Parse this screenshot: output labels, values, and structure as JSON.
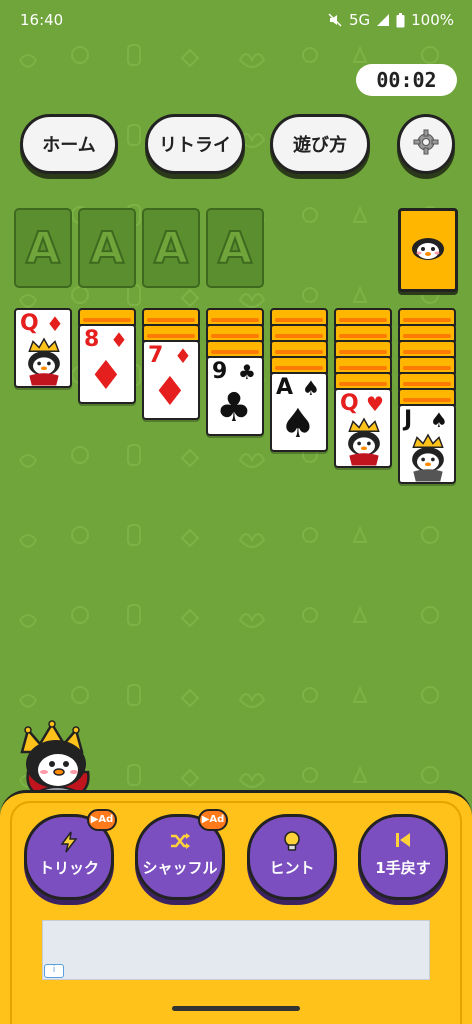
{
  "status_bar": {
    "time": "16:40",
    "network": "5G",
    "battery": "100%"
  },
  "timer": "00:02",
  "top_buttons": {
    "home": "ホーム",
    "retry": "リトライ",
    "how_to_play": "遊び方"
  },
  "foundations": [
    "A",
    "A",
    "A",
    "A"
  ],
  "tableau": [
    {
      "hidden": 0,
      "cards": [
        {
          "rank": "Q",
          "suit": "♦",
          "color": "red"
        }
      ]
    },
    {
      "hidden": 1,
      "cards": [
        {
          "rank": "8",
          "suit": "♦",
          "color": "red"
        }
      ]
    },
    {
      "hidden": 2,
      "cards": [
        {
          "rank": "7",
          "suit": "♦",
          "color": "red"
        }
      ]
    },
    {
      "hidden": 3,
      "cards": [
        {
          "rank": "9",
          "suit": "♣",
          "color": "black"
        }
      ]
    },
    {
      "hidden": 4,
      "cards": [
        {
          "rank": "A",
          "suit": "♠",
          "color": "black"
        }
      ]
    },
    {
      "hidden": 5,
      "cards": [
        {
          "rank": "Q",
          "suit": "♥",
          "color": "red"
        }
      ]
    },
    {
      "hidden": 6,
      "cards": [
        {
          "rank": "J",
          "suit": "♠",
          "color": "black"
        }
      ]
    }
  ],
  "actions": [
    {
      "label": "トリック",
      "badge": "▶Ad",
      "icon": "lightning-icon"
    },
    {
      "label": "シャッフル",
      "badge": "▶Ad",
      "icon": "shuffle-icon"
    },
    {
      "label": "ヒント",
      "badge": "",
      "icon": "lightbulb-icon"
    },
    {
      "label": "1手戻す",
      "badge": "",
      "icon": "undo-icon"
    }
  ],
  "colors": {
    "background": "#6fa53a",
    "panel": "#ffc21a",
    "action_button": "#7b4fc0",
    "card_back": "#ffb600",
    "red_suit": "#e51e1e"
  }
}
